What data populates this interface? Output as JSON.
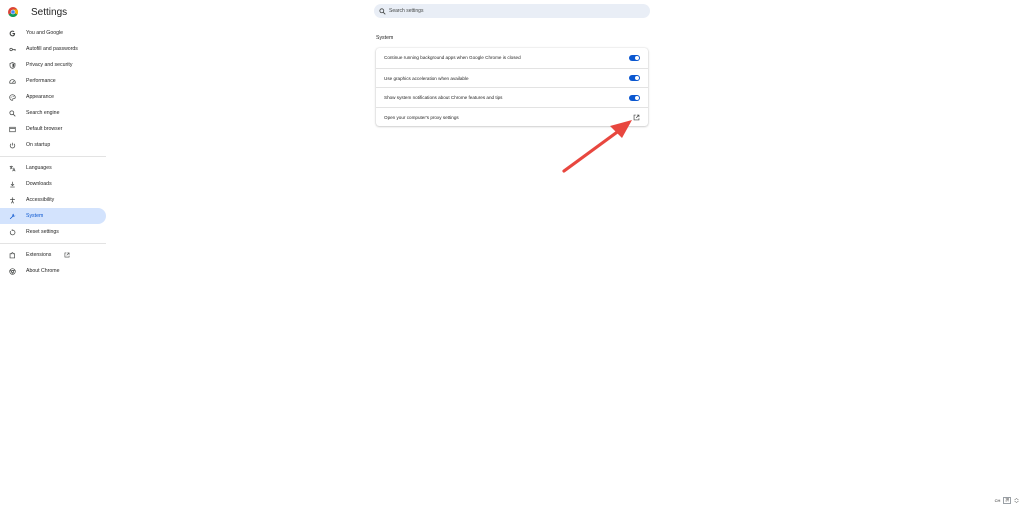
{
  "header": {
    "title": "Settings",
    "logo_icon": "chrome-logo-icon",
    "search_placeholder": "Search settings"
  },
  "sidebar": {
    "groups": [
      [
        {
          "label": "You and Google",
          "icon": "google-g-icon"
        },
        {
          "label": "Autofill and passwords",
          "icon": "key-icon"
        },
        {
          "label": "Privacy and security",
          "icon": "shield-icon"
        },
        {
          "label": "Performance",
          "icon": "speedometer-icon"
        },
        {
          "label": "Appearance",
          "icon": "palette-icon"
        },
        {
          "label": "Search engine",
          "icon": "search-icon"
        },
        {
          "label": "Default browser",
          "icon": "browser-window-icon"
        },
        {
          "label": "On startup",
          "icon": "power-icon"
        }
      ],
      [
        {
          "label": "Languages",
          "icon": "translate-icon"
        },
        {
          "label": "Downloads",
          "icon": "download-icon"
        },
        {
          "label": "Accessibility",
          "icon": "accessibility-icon"
        },
        {
          "label": "System",
          "icon": "wrench-icon",
          "active": true
        },
        {
          "label": "Reset settings",
          "icon": "reset-icon"
        }
      ],
      [
        {
          "label": "Extensions",
          "icon": "puzzle-icon",
          "external": true
        },
        {
          "label": "About Chrome",
          "icon": "chrome-outline-icon"
        }
      ]
    ]
  },
  "main": {
    "section_title": "System",
    "rows": [
      {
        "label": "Continue running background apps when Google Chrome is closed",
        "control": "toggle",
        "on": true
      },
      {
        "label": "Use graphics acceleration when available",
        "control": "toggle",
        "on": true
      },
      {
        "label": "Show system notifications about Chrome features and tips",
        "control": "toggle",
        "on": true
      },
      {
        "label": "Open your computer's proxy settings",
        "control": "open-in-new-icon"
      }
    ]
  },
  "tray": {
    "ime_mode": "CH",
    "ime_state": "拼"
  },
  "colors": {
    "accent": "#0b57d0",
    "active_nav_bg": "#d3e3fd",
    "search_bg": "#e9eef6",
    "annotation_arrow": "#e8473f"
  }
}
